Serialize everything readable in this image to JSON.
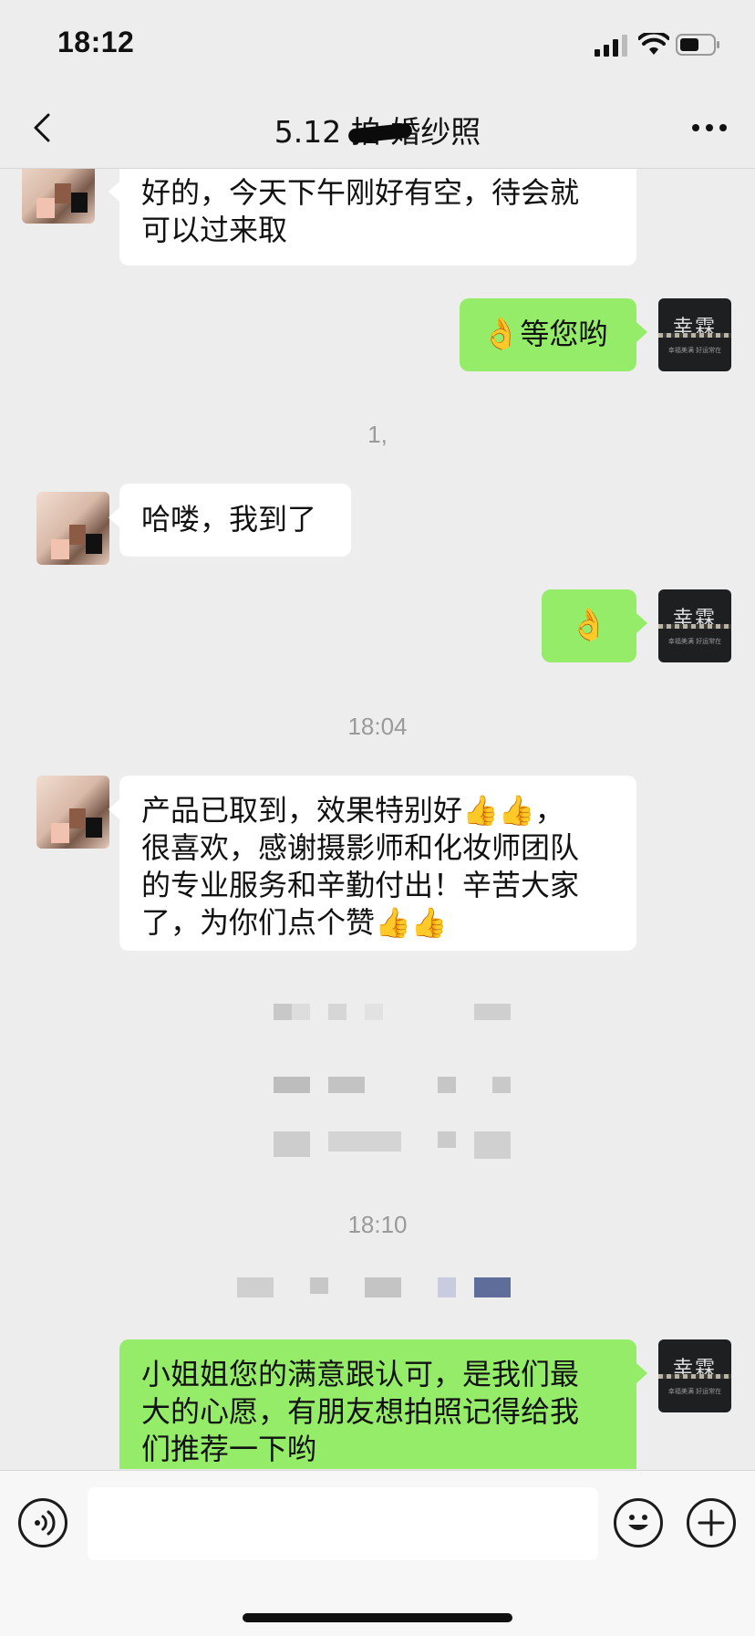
{
  "status_bar": {
    "time": "18:12"
  },
  "nav": {
    "title": "5.12 拍        婚纱照"
  },
  "messages": [
    {
      "side": "left",
      "lines": [
        "好的，今天下午刚好有空，待会就",
        "可以过来取"
      ]
    },
    {
      "side": "right",
      "emoji": "👌",
      "text": "等您哟"
    },
    {
      "type": "time",
      "text": "1,"
    },
    {
      "side": "left",
      "lines": [
        "哈喽，我到了"
      ]
    },
    {
      "side": "right",
      "emoji": "👌"
    },
    {
      "type": "time",
      "text": "18:04"
    },
    {
      "side": "left",
      "lines": [
        "产品已取到，效果特别好👍👍，",
        "很喜欢，感谢摄影师和化妆师团队",
        "的专业服务和辛勤付出！辛苦大家",
        "了，为你们点个赞👍👍"
      ]
    },
    {
      "type": "time",
      "text": "18:10"
    },
    {
      "side": "right",
      "lines": [
        "小姐姐您的满意跟认可，是我们最",
        "大的心愿，有朋友想拍照记得给我",
        "们推荐一下哟"
      ]
    }
  ],
  "avatars": {
    "studio_brand": "幸霖",
    "studio_sub": "幸福美满 好运常在"
  },
  "colors": {
    "right_bubble": "#95ec69",
    "left_bubble": "#ffffff",
    "background": "#ededed"
  },
  "icons": {
    "back": "chevron-left-icon",
    "more": "more-dots-icon",
    "voice": "voice-icon",
    "emoji": "smiley-icon",
    "plus": "plus-icon"
  }
}
